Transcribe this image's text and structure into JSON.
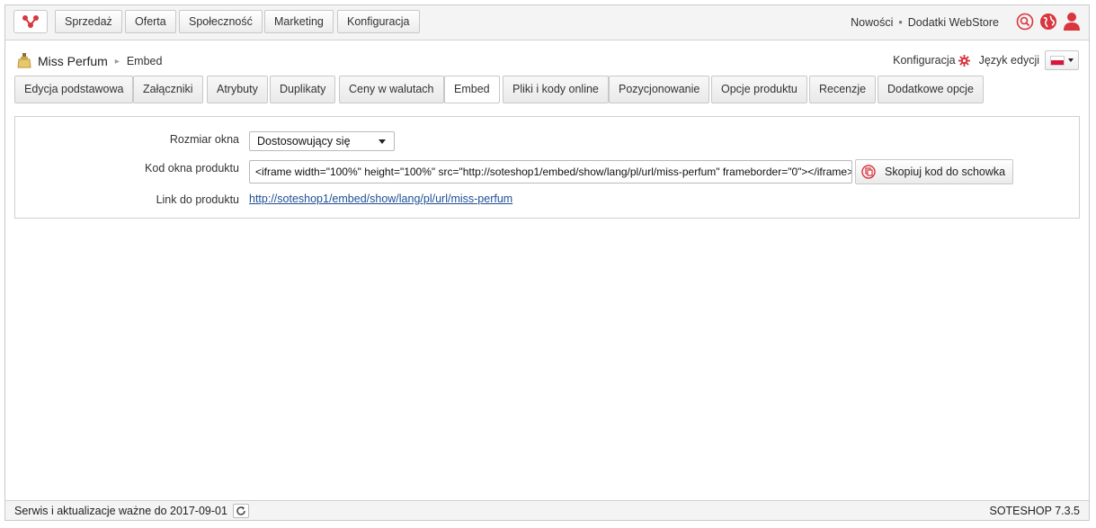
{
  "topbar": {
    "logo_icon": "soteshop-logo-icon",
    "menu": [
      "Sprzedaż",
      "Oferta",
      "Społeczność",
      "Marketing",
      "Konfiguracja"
    ],
    "links": [
      "Nowości",
      "Dodatki WebStore"
    ],
    "separator": "•",
    "icons": [
      "search-icon",
      "globe-icon",
      "user-icon"
    ]
  },
  "header": {
    "product_icon": "perfume-icon",
    "title": "Miss Perfum",
    "breadcrumb_arrow": "▸",
    "section": "Embed",
    "config_label": "Konfiguracja",
    "config_icon": "gear-icon",
    "lang_label": "Język edycji",
    "flag_icon": "poland-flag-icon",
    "flag_colors": [
      "#ffffff",
      "#dc143c"
    ]
  },
  "tabs": [
    {
      "label": "Edycja podstawowa"
    },
    {
      "label": "Załączniki"
    },
    {
      "label": "Atrybuty"
    },
    {
      "label": "Duplikaty"
    },
    {
      "label": "Ceny w walutach"
    },
    {
      "label": "Embed",
      "active": true
    },
    {
      "label": "Pliki i kody online"
    },
    {
      "label": "Pozycjonowanie"
    },
    {
      "label": "Opcje produktu"
    },
    {
      "label": "Recenzje"
    },
    {
      "label": "Dodatkowe opcje"
    }
  ],
  "form": {
    "size_label": "Rozmiar okna",
    "size_value": "Dostosowujący się",
    "code_label": "Kod okna produktu",
    "code_value": "<iframe width=\"100%\" height=\"100%\" src=\"http://soteshop1/embed/show/lang/pl/url/miss-perfum\" frameborder=\"0\"></iframe>",
    "copy_label": "Skopiuj kod do schowka",
    "copy_icon": "copy-icon",
    "link_label": "Link do produktu",
    "link_value": "http://soteshop1/embed/show/lang/pl/url/miss-perfum"
  },
  "footer": {
    "service_text": "Serwis i aktualizacje ważne do 2017-09-01",
    "refresh_icon": "refresh-icon",
    "version": "SOTESHOP 7.3.5"
  },
  "colors": {
    "accent": "#d9363e",
    "link": "#1f4f94"
  }
}
